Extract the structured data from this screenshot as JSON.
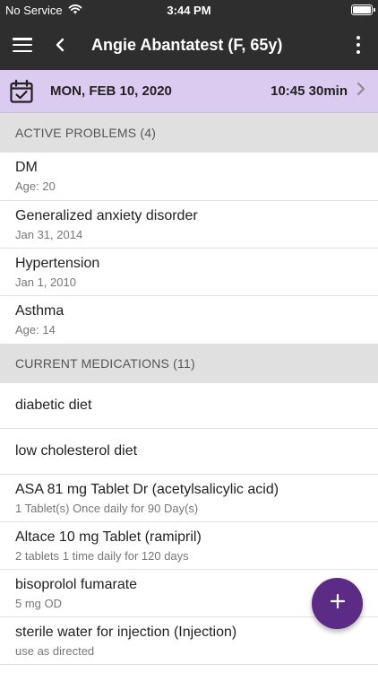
{
  "status_bar": {
    "carrier": "No Service",
    "time": "3:44 PM"
  },
  "app_bar": {
    "title": "Angie Abantatest (F, 65y)"
  },
  "encounter": {
    "date": "MON, FEB 10, 2020",
    "time": "10:45 30min"
  },
  "active_problems": {
    "header": "ACTIVE PROBLEMS (4)",
    "items": [
      {
        "name": "DM",
        "detail": "Age: 20"
      },
      {
        "name": "Generalized anxiety disorder",
        "detail": "Jan 31, 2014"
      },
      {
        "name": "Hypertension",
        "detail": "Jan 1, 2010"
      },
      {
        "name": "Asthma",
        "detail": "Age: 14"
      }
    ]
  },
  "current_medications": {
    "header": "CURRENT MEDICATIONS (11)",
    "items": [
      {
        "name": "diabetic diet"
      },
      {
        "name": "low cholesterol diet"
      },
      {
        "name": "ASA 81 mg Tablet Dr (acetylsalicylic acid)",
        "detail": "1 Tablet(s) Once daily for 90 Day(s)"
      },
      {
        "name": "Altace 10 mg Tablet (ramipril)",
        "detail": "2 tablets 1 time daily for 120 days"
      },
      {
        "name": "bisoprolol fumarate",
        "detail": "5 mg OD"
      },
      {
        "name": "sterile water for injection (Injection)",
        "detail": "use as directed"
      }
    ]
  },
  "fab": {
    "icon": "plus-icon"
  },
  "colors": {
    "app_bar": "#2e2e2e",
    "date_bar": "#dccbf0",
    "accent": "#5b2b86",
    "section_header": "#e0e0e0"
  }
}
